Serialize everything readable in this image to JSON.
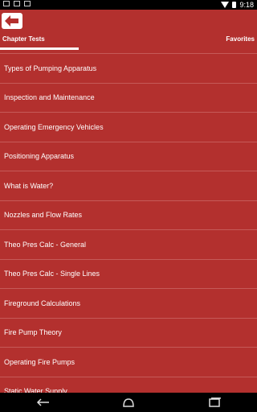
{
  "status": {
    "time": "9:18"
  },
  "tabs": {
    "left": "Chapter Tests",
    "right": "Favorites"
  },
  "items": [
    {
      "label": "Types of Pumping Apparatus"
    },
    {
      "label": "Inspection and Maintenance"
    },
    {
      "label": "Operating Emergency Vehicles"
    },
    {
      "label": "Positioning Apparatus"
    },
    {
      "label": "What is Water?"
    },
    {
      "label": "Nozzles and Flow Rates"
    },
    {
      "label": "Theo Pres Calc - General"
    },
    {
      "label": "Theo Pres Calc - Single Lines"
    },
    {
      "label": "Fireground Calculations"
    },
    {
      "label": "Fire Pump Theory"
    },
    {
      "label": "Operating Fire Pumps"
    },
    {
      "label": "Static Water Supply"
    }
  ],
  "colors": {
    "accent": "#b3302e"
  }
}
